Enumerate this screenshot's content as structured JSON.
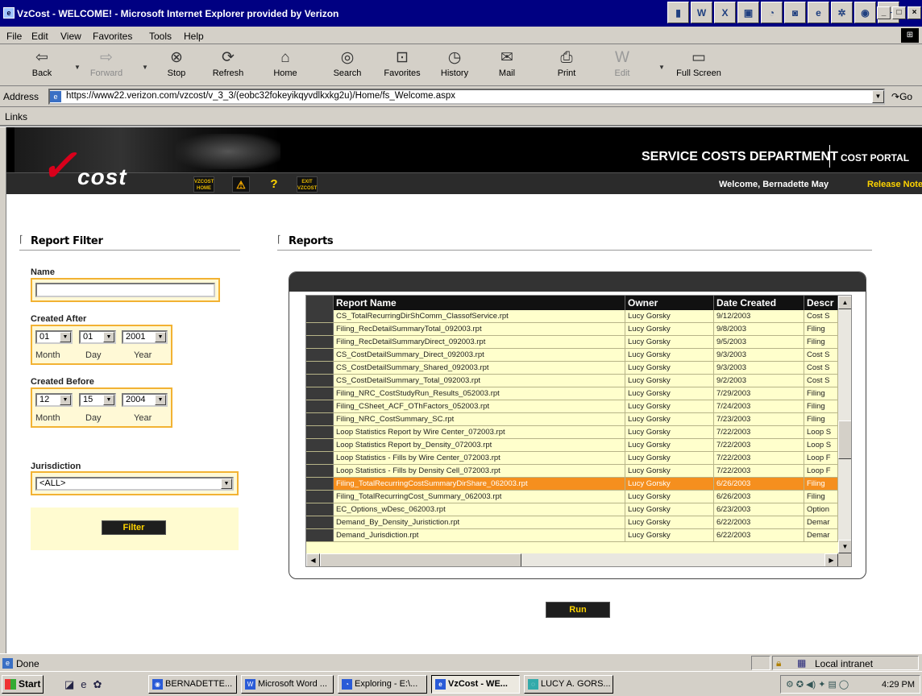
{
  "window": {
    "title": "VzCost - WELCOME! - Microsoft Internet Explorer provided by Verizon"
  },
  "menu": [
    "File",
    "Edit",
    "View",
    "Favorites",
    "Tools",
    "Help"
  ],
  "toolbar": {
    "back": "Back",
    "forward": "Forward",
    "stop": "Stop",
    "refresh": "Refresh",
    "home": "Home",
    "search": "Search",
    "favorites": "Favorites",
    "history": "History",
    "mail": "Mail",
    "print": "Print",
    "edit": "Edit",
    "fullscreen": "Full Screen"
  },
  "address": {
    "label": "Address",
    "url": "https://www22.verizon.com/vzcost/v_3_3/(eobc32fokeyikqyvdlkxkg2u)/Home/fs_Welcome.aspx",
    "go": "Go"
  },
  "links": {
    "label": "Links"
  },
  "header": {
    "logo_text": "cost",
    "department": "SERVICE COSTS DEPARTMENT",
    "portal": "COST PORTAL",
    "welcome": "Welcome, Bernadette May",
    "release_notes": "Release Notes",
    "nav": {
      "home_1": "VZCOST",
      "home_2": "HOME",
      "exit_1": "EXIT",
      "exit_2": "VZCOST"
    }
  },
  "filter": {
    "title": "Report Filter",
    "name_label": "Name",
    "name_value": "",
    "created_after_label": "Created After",
    "created_after": {
      "month": "01",
      "day": "01",
      "year": "2001"
    },
    "created_before_label": "Created Before",
    "created_before": {
      "month": "12",
      "day": "15",
      "year": "2004"
    },
    "month_label": "Month",
    "day_label": "Day",
    "year_label": "Year",
    "jurisdiction_label": "Jurisdiction",
    "jurisdiction_value": "<ALL>",
    "filter_button": "Filter"
  },
  "reports": {
    "title": "Reports",
    "columns": [
      "Report Name",
      "Owner",
      "Date Created",
      "Descr"
    ],
    "rows": [
      [
        "CS_TotalRecurringDirShComm_ClassofService.rpt",
        "Lucy Gorsky",
        "9/12/2003",
        "Cost S"
      ],
      [
        "Filing_RecDetailSummaryTotal_092003.rpt",
        "Lucy Gorsky",
        "9/8/2003",
        "Filing"
      ],
      [
        "Filing_RecDetailSummaryDirect_092003.rpt",
        "Lucy Gorsky",
        "9/5/2003",
        "Filing"
      ],
      [
        "CS_CostDetailSummary_Direct_092003.rpt",
        "Lucy Gorsky",
        "9/3/2003",
        "Cost S"
      ],
      [
        "CS_CostDetailSummary_Shared_092003.rpt",
        "Lucy Gorsky",
        "9/3/2003",
        "Cost S"
      ],
      [
        "CS_CostDetailSummary_Total_092003.rpt",
        "Lucy Gorsky",
        "9/2/2003",
        "Cost S"
      ],
      [
        "Filing_NRC_CostStudyRun_Results_052003.rpt",
        "Lucy Gorsky",
        "7/29/2003",
        "Filing"
      ],
      [
        "Filing_CSheet_ACF_OThFactors_052003.rpt",
        "Lucy Gorsky",
        "7/24/2003",
        "Filing"
      ],
      [
        "Filing_NRC_CostSummary_SC.rpt",
        "Lucy Gorsky",
        "7/23/2003",
        "Filing"
      ],
      [
        "Loop Statistics Report by Wire Center_072003.rpt",
        "Lucy Gorsky",
        "7/22/2003",
        "Loop S"
      ],
      [
        "Loop Statistics Report by_Density_072003.rpt",
        "Lucy Gorsky",
        "7/22/2003",
        "Loop S"
      ],
      [
        "Loop Statistics - Fills by Wire Center_072003.rpt",
        "Lucy Gorsky",
        "7/22/2003",
        "Loop F"
      ],
      [
        "Loop Statistics - Fills by Density Cell_072003.rpt",
        "Lucy Gorsky",
        "7/22/2003",
        "Loop F"
      ],
      [
        "Filing_TotalRecurringCostSummaryDirShare_062003.rpt",
        "Lucy Gorsky",
        "6/26/2003",
        "Filing"
      ],
      [
        "Filing_TotalRecurringCost_Summary_062003.rpt",
        "Lucy Gorsky",
        "6/26/2003",
        "Filing"
      ],
      [
        "EC_Options_wDesc_062003.rpt",
        "Lucy Gorsky",
        "6/23/2003",
        "Option"
      ],
      [
        "Demand_By_Density_Juristiction.rpt",
        "Lucy Gorsky",
        "6/22/2003",
        "Demar"
      ],
      [
        "Demand_Jurisdiction.rpt",
        "Lucy Gorsky",
        "6/22/2003",
        "Demar"
      ]
    ],
    "highlighted_row": 13,
    "run_button": "Run"
  },
  "status": {
    "text": "Done",
    "zone": "Local intranet"
  },
  "taskbar": {
    "start": "Start",
    "tasks": [
      "BERNADETTE...",
      "Microsoft Word ...",
      "Exploring - E:\\...",
      "VzCost - WE...",
      "LUCY A. GORS..."
    ],
    "clock": "4:29 PM"
  },
  "colors": {
    "accent": "#f2b233",
    "highlight": "#f58f1e",
    "row_bg": "#ffffcc",
    "brand_red": "#d9001b"
  }
}
